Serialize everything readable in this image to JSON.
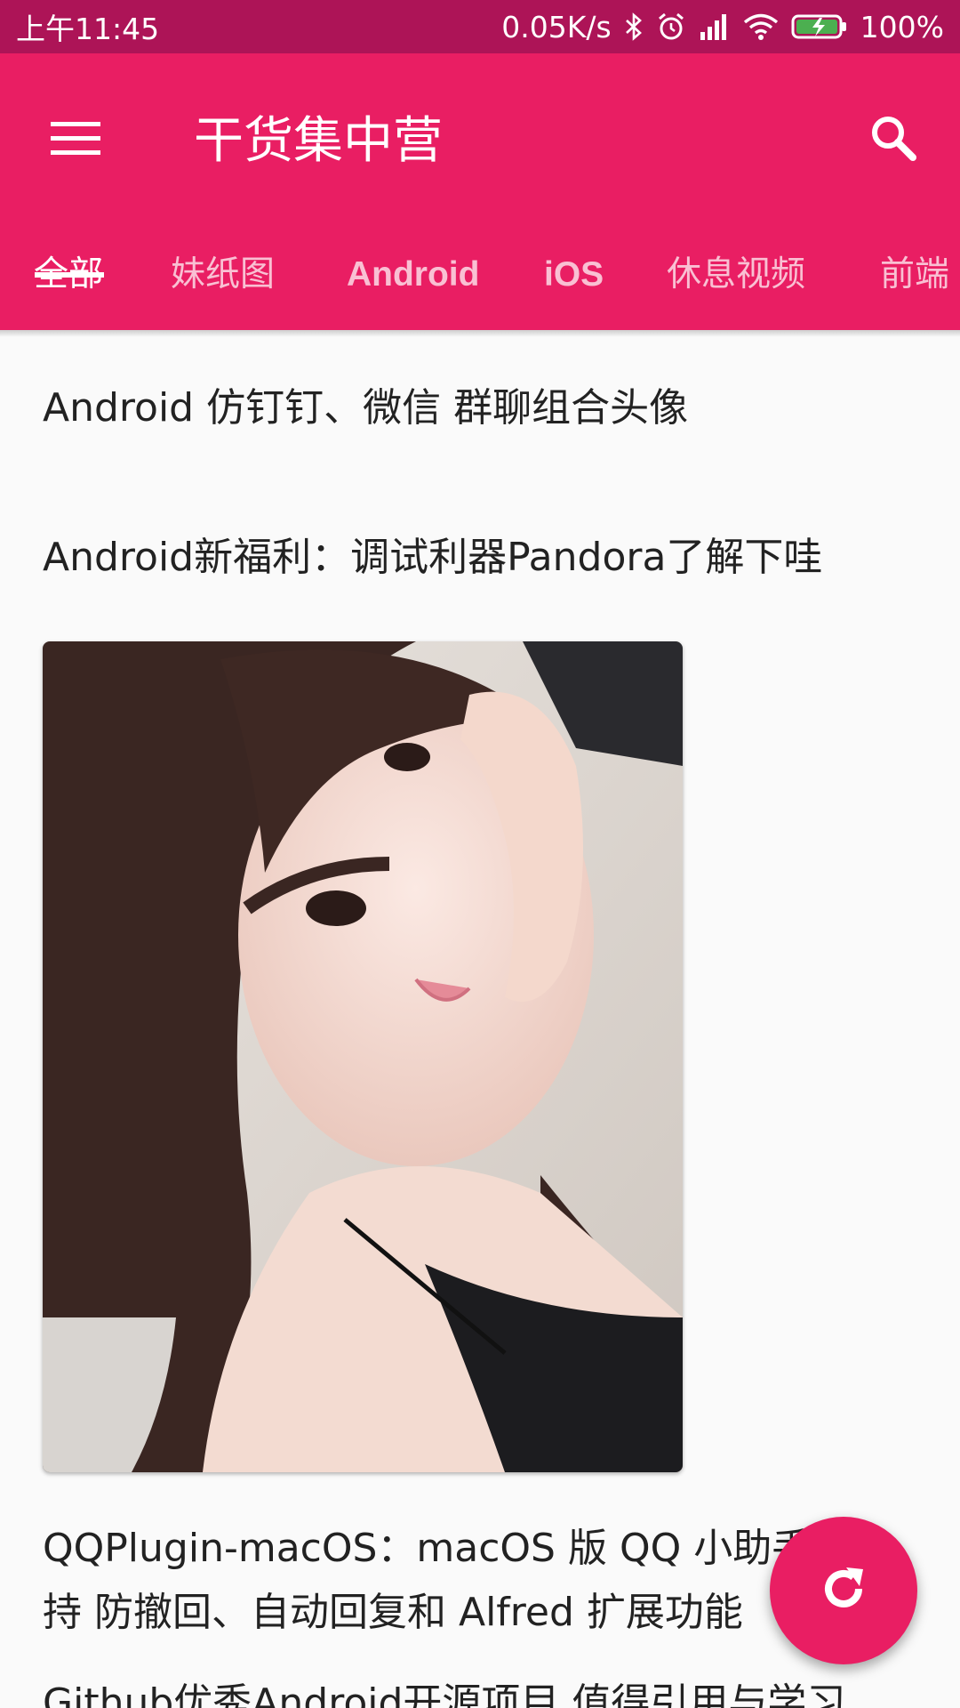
{
  "status_bar": {
    "time": "上午11:45",
    "net_speed": "0.05K/s",
    "battery": "100%",
    "icons": [
      "bluetooth-icon",
      "alarm-icon",
      "signal-icon",
      "wifi-icon",
      "battery-icon"
    ]
  },
  "app_bar": {
    "title": "干货集中营",
    "menu_icon": "menu-icon",
    "search_icon": "search-icon",
    "color": "#e91e63",
    "status_color": "#ad1457"
  },
  "tabs": [
    {
      "label": "全部",
      "active": true
    },
    {
      "label": "妹纸图",
      "active": false
    },
    {
      "label": "Android",
      "active": false
    },
    {
      "label": "iOS",
      "active": false
    },
    {
      "label": "休息视频",
      "active": false
    },
    {
      "label": "前端",
      "active": false
    }
  ],
  "feed": {
    "items": [
      {
        "title": "Android 仿钉钉、微信 群聊组合头像"
      },
      {
        "title": "Android新福利：调试利器Pandora了解下哇"
      },
      {
        "title": "QQPlugin-macOS：macOS 版 QQ 小助手，支持 防撤回、自动回复和 Alfred 扩展功能"
      },
      {
        "title": "Github优秀Android开源项目,值得引用与学习"
      }
    ]
  },
  "fab": {
    "icon": "refresh-icon"
  }
}
